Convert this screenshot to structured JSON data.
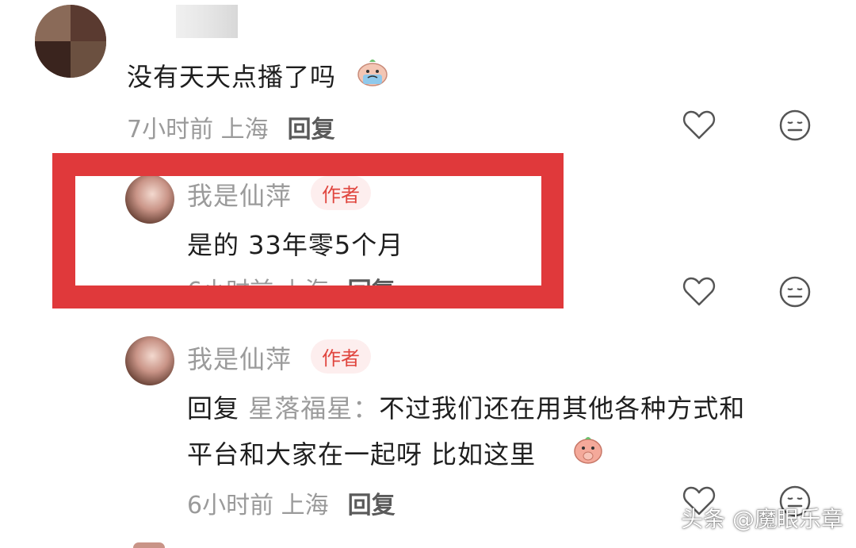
{
  "comment1": {
    "text": "没有天天点播了吗",
    "time": "7小时前",
    "location": "上海",
    "reply_label": "回复"
  },
  "reply1": {
    "author": "我是仙萍",
    "author_tag": "作者",
    "text": "是的 33年零5个月",
    "time": "6小时前",
    "location": "上海",
    "reply_label": "回复"
  },
  "reply2": {
    "author": "我是仙萍",
    "author_tag": "作者",
    "prefix": "回复",
    "mention": "星落福星：",
    "text_line1": "不过我们还在用其他各种方式和",
    "text_line2": "平台和大家在一起呀 比如这里",
    "time": "6小时前",
    "location": "上海",
    "reply_label": "回复"
  },
  "watermark": "头条 @魔眼乐章",
  "icons": {
    "like": "heart-outline-icon",
    "dislike": "neutral-face-icon",
    "emoji1": "crying-face-emoji",
    "emoji2": "covering-mouth-emoji"
  },
  "colors": {
    "highlight_frame": "#e0393b",
    "author_tag": "#e0463f"
  }
}
